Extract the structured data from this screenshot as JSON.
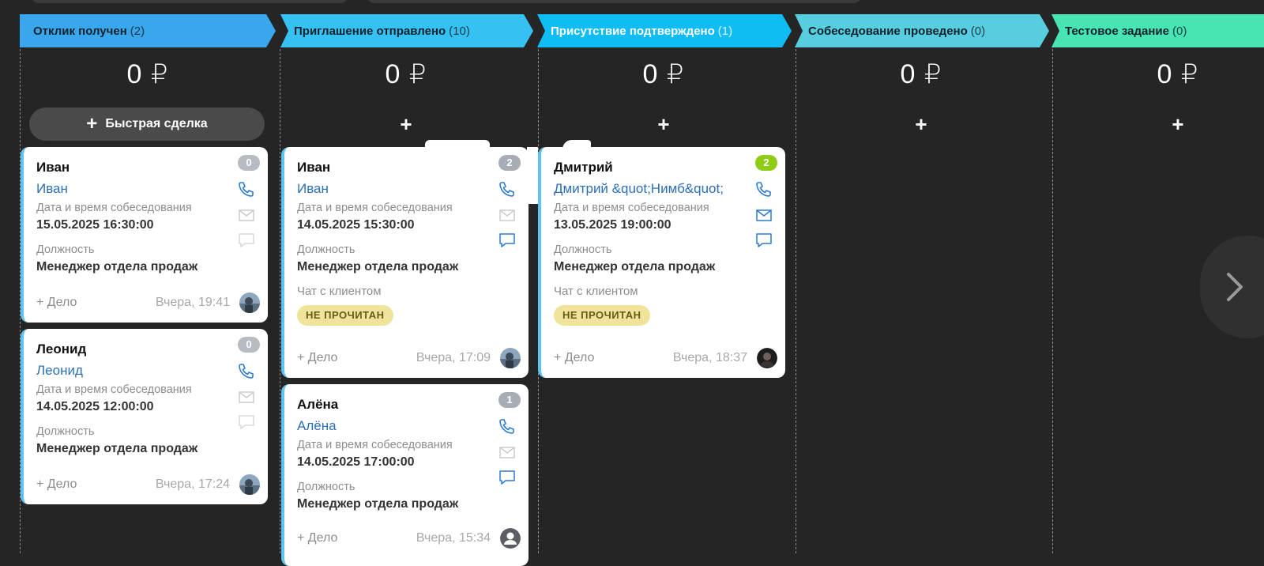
{
  "stages": [
    {
      "id": "s1",
      "name": "Отклик получен",
      "count": "(2)",
      "sum": "0 ₽",
      "color": "#3aa7ec"
    },
    {
      "id": "s2",
      "name": "Приглашение отправлено",
      "count": "(10)",
      "sum": "0 ₽",
      "color": "#35c2f2"
    },
    {
      "id": "s3",
      "name": "Присутствие подтверждено",
      "count": "(1)",
      "sum": "0 ₽",
      "color": "#0fbdf4"
    },
    {
      "id": "s4",
      "name": "Собеседование проведено",
      "count": "(0)",
      "sum": "0 ₽",
      "color": "#57cde0"
    },
    {
      "id": "s5",
      "name": "Тестовое задание",
      "count": "(0)",
      "sum": "0 ₽",
      "color": "#48e4b3"
    }
  ],
  "quick_deal": {
    "plus": "+",
    "label": "Быстрая сделка"
  },
  "add_plus": "+",
  "cards": {
    "s1c1": {
      "title": "Иван",
      "contact": "Иван",
      "badge": "0",
      "badge_color": "#b7bcc2",
      "date_label": "Дата и время собеседования",
      "date": "15.05.2025 16:30:00",
      "position_label": "Должность",
      "position": "Менеджер отдела продаж",
      "add": "+ Дело",
      "time": "Вчера, 19:41",
      "avatar": "photo"
    },
    "s1c2": {
      "title": "Леонид",
      "contact": "Леонид",
      "badge": "0",
      "badge_color": "#b7bcc2",
      "date_label": "Дата и время собеседования",
      "date": "14.05.2025 12:00:00",
      "position_label": "Должность",
      "position": "Менеджер отдела продаж",
      "add": "+ Дело",
      "time": "Вчера, 17:24",
      "avatar": "photo"
    },
    "s2c1": {
      "title": "Иван",
      "contact": "Иван",
      "badge": "2",
      "badge_color": "#a7adb4",
      "date_label": "Дата и время собеседования",
      "date": "14.05.2025 15:30:00",
      "position_label": "Должность",
      "position": "Менеджер отдела продаж",
      "chat_label": "Чат с клиентом",
      "tag": "НЕ ПРОЧИТАН",
      "add": "+ Дело",
      "time": "Вчера, 17:09",
      "avatar": "photo"
    },
    "s2c2": {
      "title": "Алёна",
      "contact": "Алёна",
      "badge": "1",
      "badge_color": "#a7adb4",
      "date_label": "Дата и время собеседования",
      "date": "14.05.2025 17:00:00",
      "position_label": "Должность",
      "position": "Менеджер отдела продаж",
      "add": "+ Дело",
      "time": "Вчера, 15:34",
      "avatar": "placeholder"
    },
    "s3c1": {
      "title": "Дмитрий",
      "contact": "Дмитрий &quot;Нимб&quot;",
      "badge": "2",
      "badge_color": "#8fcc16",
      "date_label": "Дата и время собеседования",
      "date": "13.05.2025 19:00:00",
      "position_label": "Должность",
      "position": "Менеджер отдела продаж",
      "chat_label": "Чат с клиентом",
      "tag": "НЕ ПРОЧИТАН",
      "add": "+ Дело",
      "time": "Вчера, 18:37",
      "avatar": "dark"
    }
  },
  "icons": {
    "phone": "phone-icon",
    "mail": "mail-icon",
    "chat": "chat-icon",
    "next": "chevron-right-icon"
  }
}
